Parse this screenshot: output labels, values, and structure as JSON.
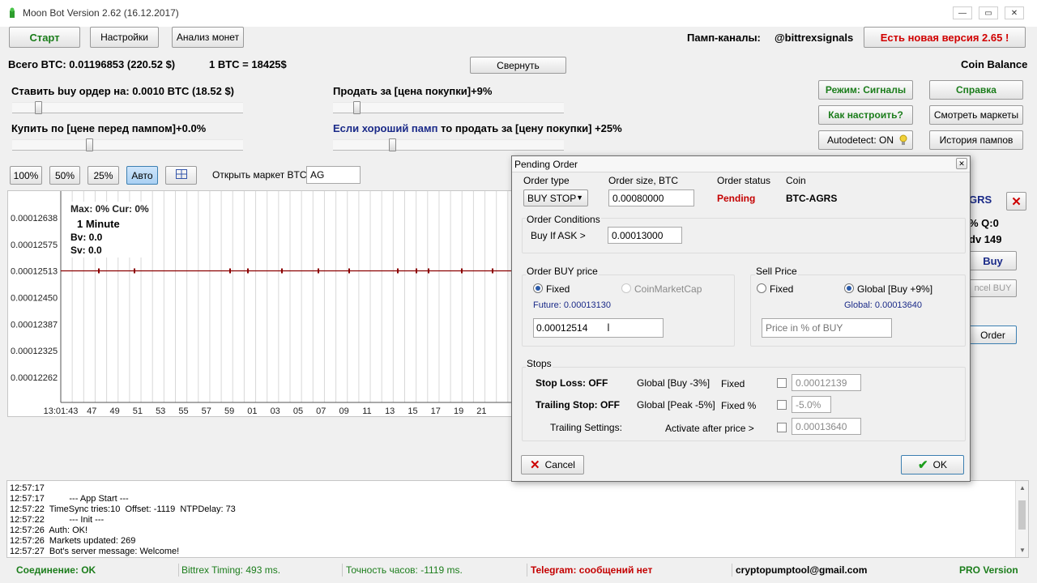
{
  "window": {
    "title": "Moon Bot Version 2.62 (16.12.2017)",
    "minimize": "—",
    "maximize": "▭",
    "close": "✕"
  },
  "toolbar": {
    "start": "Старт",
    "settings": "Настройки",
    "analyze": "Анализ монет",
    "pump_label": "Памп-каналы:",
    "pump_channel": "@bittrexsignals",
    "new_version": "Есть новая версия 2.65 !"
  },
  "info": {
    "total_btc": "Всего BTC: 0.01196853 (220.52 $)",
    "btc_rate": "1 BTC = 18425$",
    "collapse": "Свернуть",
    "coin_balance": "Coin Balance"
  },
  "params": {
    "buy_order": "Ставить buy ордер на: 0.0010 BTC  (18.52 $)",
    "sell_for": "Продать за [цена покупки]+9%",
    "buy_at": "Купить по [цене перед пампом]+0.0%",
    "good_pump_prefix": "Если хороший памп",
    "good_pump_suffix": "то продать за [цену покупки] +25%",
    "slider_buy_order": 0.1,
    "slider_sell": 0.09,
    "slider_buy_at": 0.33,
    "slider_good_pump": 0.25
  },
  "right_buttons": {
    "mode": "Режим: Сигналы",
    "help": "Справка",
    "how_to": "Как настроить?",
    "markets": "Смотреть маркеты",
    "autodetect": "Autodetect: ON",
    "pump_history": "История пампов"
  },
  "market_bar": {
    "p100": "100%",
    "p50": "50%",
    "p25": "25%",
    "auto": "Авто",
    "open_market_label": "Открыть маркет BTC-",
    "open_market_value": "AG"
  },
  "chart_info": {
    "max_cur": "Max: 0%   Cur: 0%",
    "interval": "1 Minute",
    "bv": "Bv: 0.0",
    "sv": "Sv: 0.0"
  },
  "chart_data": {
    "type": "line",
    "y_ticks": [
      "0.00012638",
      "0.00012575",
      "0.00012513",
      "0.00012450",
      "0.00012387",
      "0.00012325",
      "0.00012262"
    ],
    "x_ticks": [
      "13:01:43",
      "47",
      "49",
      "51",
      "53",
      "55",
      "57",
      "59",
      "01",
      "03",
      "05",
      "07",
      "09",
      "11",
      "13",
      "15",
      "17",
      "19",
      "21"
    ],
    "ylim": [
      0.00012262,
      0.00012638
    ],
    "series": [
      {
        "values": [
          0.00012513,
          0.00012513
        ]
      }
    ],
    "grid": true,
    "line_color": "#8b0000"
  },
  "side_panel": {
    "coin": "GRS",
    "q": "% Q:0",
    "dv": "dv 149",
    "buy": "Buy",
    "cancel_buy": "ncel BUY",
    "order": "Order"
  },
  "dialog": {
    "title": "Pending Order",
    "close": "✕",
    "order_type_label": "Order type",
    "order_type_value": "BUY STOP",
    "order_size_label": "Order size, BTC",
    "order_size_value": "0.00080000",
    "order_status_label": "Order status",
    "order_status_value": "Pending",
    "coin_label": "Coin",
    "coin_value": "BTC-AGRS",
    "conditions_label": "Order Conditions",
    "buy_if_ask": "Buy If ASK >",
    "buy_if_ask_value": "0.00013000",
    "buy_price_label": "Order BUY price",
    "fixed": "Fixed",
    "coinmarketcap": "CoinMarketCap",
    "future": "Future: 0.00013130",
    "buy_price_value": "0.00012514",
    "sell_price_label": "Sell Price",
    "sell_fixed": "Fixed",
    "sell_global": "Global [Buy +9%]",
    "sell_global_value": "Global: 0.00013640",
    "sell_placeholder": "Price in % of BUY",
    "stops_label": "Stops",
    "stop_loss": "Stop Loss: OFF",
    "stop_loss_global": "Global [Buy -3%]",
    "stop_loss_fixed": "Fixed",
    "stop_loss_value": "0.00012139",
    "trailing_stop": "Trailing Stop: OFF",
    "trailing_global": "Global [Peak -5%]",
    "trailing_fixed": "Fixed %",
    "trailing_value": "-5.0%",
    "trailing_settings": "Trailing Settings:",
    "activate_after": "Activate after price >",
    "activate_value": "0.00013640",
    "cancel": "Cancel",
    "ok": "OK"
  },
  "log": [
    "12:57:17",
    "12:57:17          --- App Start ---",
    "12:57:22  TimeSync tries:10  Offset: -1119  NTPDelay: 73",
    "12:57:22          --- Init ---",
    "12:57:26  Auth: OK!",
    "12:57:26  Markets updated: 269",
    "12:57:27  Bot's server message: Welcome!"
  ],
  "status": {
    "connection": "Соединение:  OK",
    "timing": "Bittrex Timing: 493 ms.",
    "clock": "Точность часов: -1119 ms.",
    "telegram": "Telegram: сообщений нет",
    "email": "cryptopumptool@gmail.com",
    "version": "PRO Version"
  }
}
